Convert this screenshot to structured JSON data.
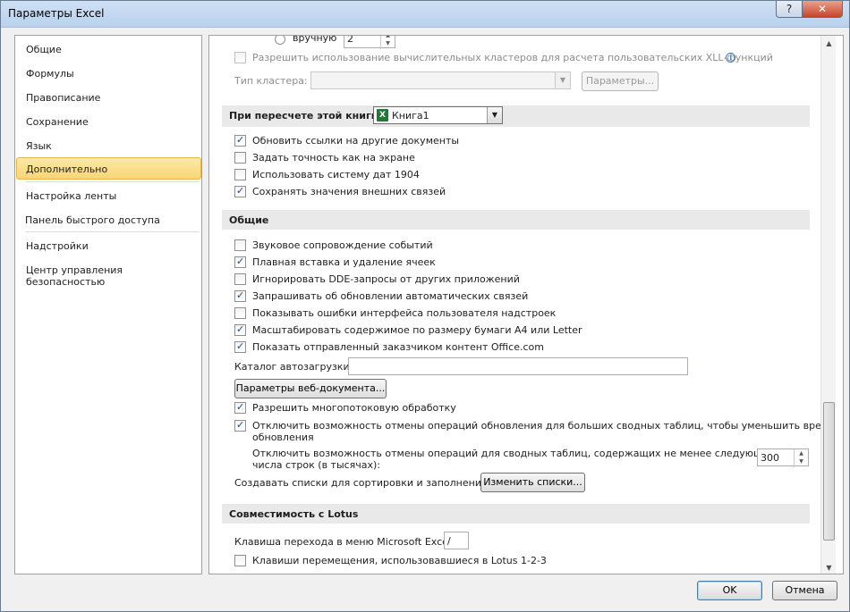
{
  "window": {
    "title": "Параметры Excel",
    "help_glyph": "?",
    "close_glyph": "✕"
  },
  "sidebar": {
    "items": [
      {
        "label": "Общие"
      },
      {
        "label": "Формулы"
      },
      {
        "label": "Правописание"
      },
      {
        "label": "Сохранение"
      },
      {
        "label": "Язык"
      },
      {
        "label": "Дополнительно",
        "selected": true
      },
      {
        "label": "Настройка ленты"
      },
      {
        "label": "Панель быстрого доступа"
      },
      {
        "label": "Надстройки"
      },
      {
        "label": "Центр управления безопасностью"
      }
    ]
  },
  "top": {
    "radio_manual_label": "вручную",
    "manual_threads_value": "2",
    "xll_cluster_label": "Разрешить использование вычислительных кластеров для расчета пользовательских XLL-функций",
    "cluster_type_label": "Тип кластера:",
    "cluster_params_button": "Параметры..."
  },
  "recalc": {
    "header": "При пересчете этой книги:",
    "workbook": "Книга1",
    "options": [
      {
        "label": "Обновить ссылки на другие документы",
        "checked": true
      },
      {
        "label": "Задать точность как на экране",
        "checked": false
      },
      {
        "label": "Использовать систему дат 1904",
        "checked": false
      },
      {
        "label": "Сохранять значения внешних связей",
        "checked": true
      }
    ]
  },
  "general": {
    "header": "Общие",
    "options": [
      {
        "label": "Звуковое сопровождение событий",
        "checked": false
      },
      {
        "label": "Плавная вставка и удаление ячеек",
        "checked": true
      },
      {
        "label": "Игнорировать DDE-запросы от других приложений",
        "checked": false
      },
      {
        "label": "Запрашивать об обновлении автоматических связей",
        "checked": true
      },
      {
        "label": "Показывать ошибки интерфейса пользователя надстроек",
        "checked": false
      },
      {
        "label": "Масштабировать содержимое по размеру бумаги A4 или Letter",
        "checked": true
      },
      {
        "label": "Показать отправленный заказчиком контент Office.com",
        "checked": true
      }
    ],
    "autoload_label": "Каталог автозагрузки:",
    "autoload_value": "",
    "web_options_button": "Параметры веб-документа...",
    "multithread_label": "Разрешить многопотоковую обработку",
    "multithread_checked": true,
    "disable_undo_large_line1": "Отключить возможность отмены операций обновления для больших сводных таблиц, чтобы уменьшить время",
    "disable_undo_large_line2": "обновления",
    "disable_undo_large_checked": true,
    "undo_rows_line1": "Отключить возможность отмены операций для сводных таблиц, содержащих не менее следующего",
    "undo_rows_line2": "числа строк (в тысячах):",
    "undo_rows_value": "300",
    "custom_lists_label": "Создавать списки для сортировки и заполнения:",
    "custom_lists_button": "Изменить списки..."
  },
  "lotus": {
    "header": "Совместимость с Lotus",
    "menu_key_label": "Клавиша перехода в меню Microsoft Excel:",
    "menu_key_value": "/",
    "nav_keys_label": "Клавиши перемещения, использовавшиеся в Lotus 1-2-3",
    "nav_keys_checked": false
  },
  "footer": {
    "ok_label": "OK",
    "cancel_label": "Отмена"
  }
}
